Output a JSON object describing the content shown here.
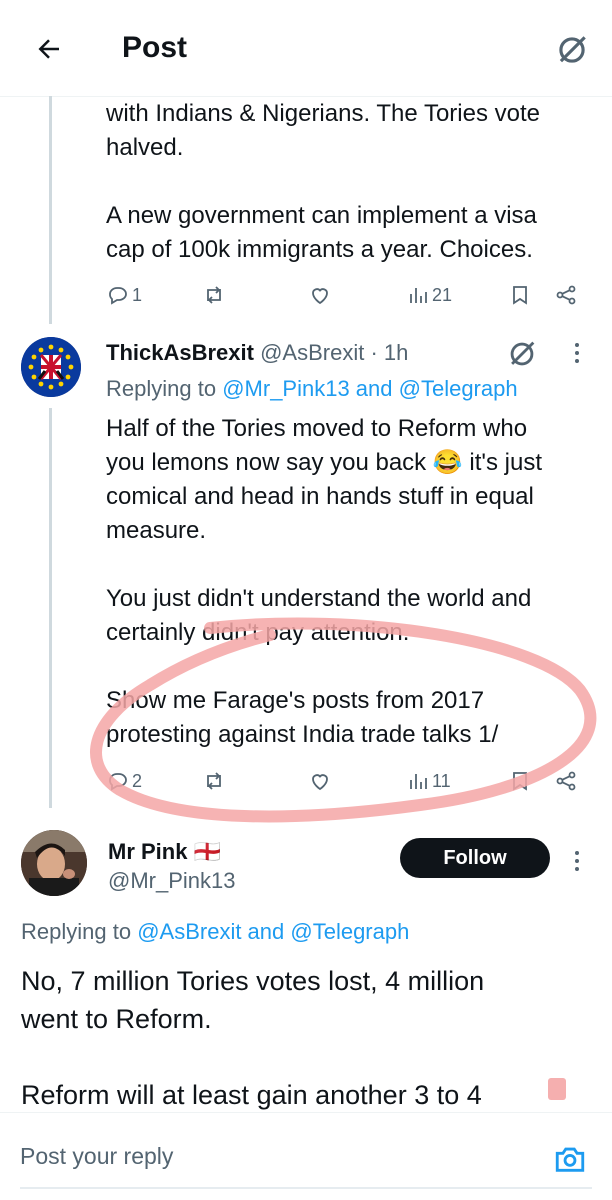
{
  "header": {
    "title": "Post"
  },
  "tweet_prev": {
    "text": "with Indians & Nigerians. The Tories vote\nhalved.\n\nA new government can implement a visa\ncap of 100k immigrants a year. Choices.",
    "actions": {
      "replies": "1",
      "reposts": "",
      "likes": "",
      "views": "21"
    }
  },
  "tweet_reply": {
    "name": "ThickAsBrexit",
    "handle": "@AsBrexit",
    "time": "· 1h",
    "replying_prefix": "Replying to",
    "replying_mentions": "@Mr_Pink13 and @Telegraph",
    "text": "Half of the Tories moved to Reform who\nyou lemons now say you back 😂 it's just\ncomical and head in hands stuff in equal\nmeasure.\n\nYou just didn't understand the world and\ncertainly didn't pay attention.\n\nShow me Farage's posts from 2017\nprotesting against India trade talks 1/",
    "actions": {
      "replies": "2",
      "reposts": "",
      "likes": "",
      "views": "11"
    }
  },
  "tweet_main": {
    "name": "Mr Pink 🏴󠁧󠁢󠁥󠁮󠁧󠁿",
    "handle": "@Mr_Pink13",
    "follow_label": "Follow",
    "replying_prefix": "Replying to",
    "replying_mentions": "@AsBrexit and @Telegraph",
    "text": "No, 7 million Tories votes lost, 4 million\nwent to Reform.\n\nReform will at least gain another 3 to 4"
  },
  "reply_bar": {
    "placeholder": "Post your reply"
  },
  "colors": {
    "accent": "#1d9bf0",
    "secondary_text": "#536471",
    "annotation_circle": "#f4a6a6"
  },
  "icons": [
    "back-arrow-icon",
    "grok-icon",
    "reply-icon",
    "repost-icon",
    "like-icon",
    "views-icon",
    "bookmark-icon",
    "share-icon",
    "more-icon",
    "camera-icon"
  ]
}
